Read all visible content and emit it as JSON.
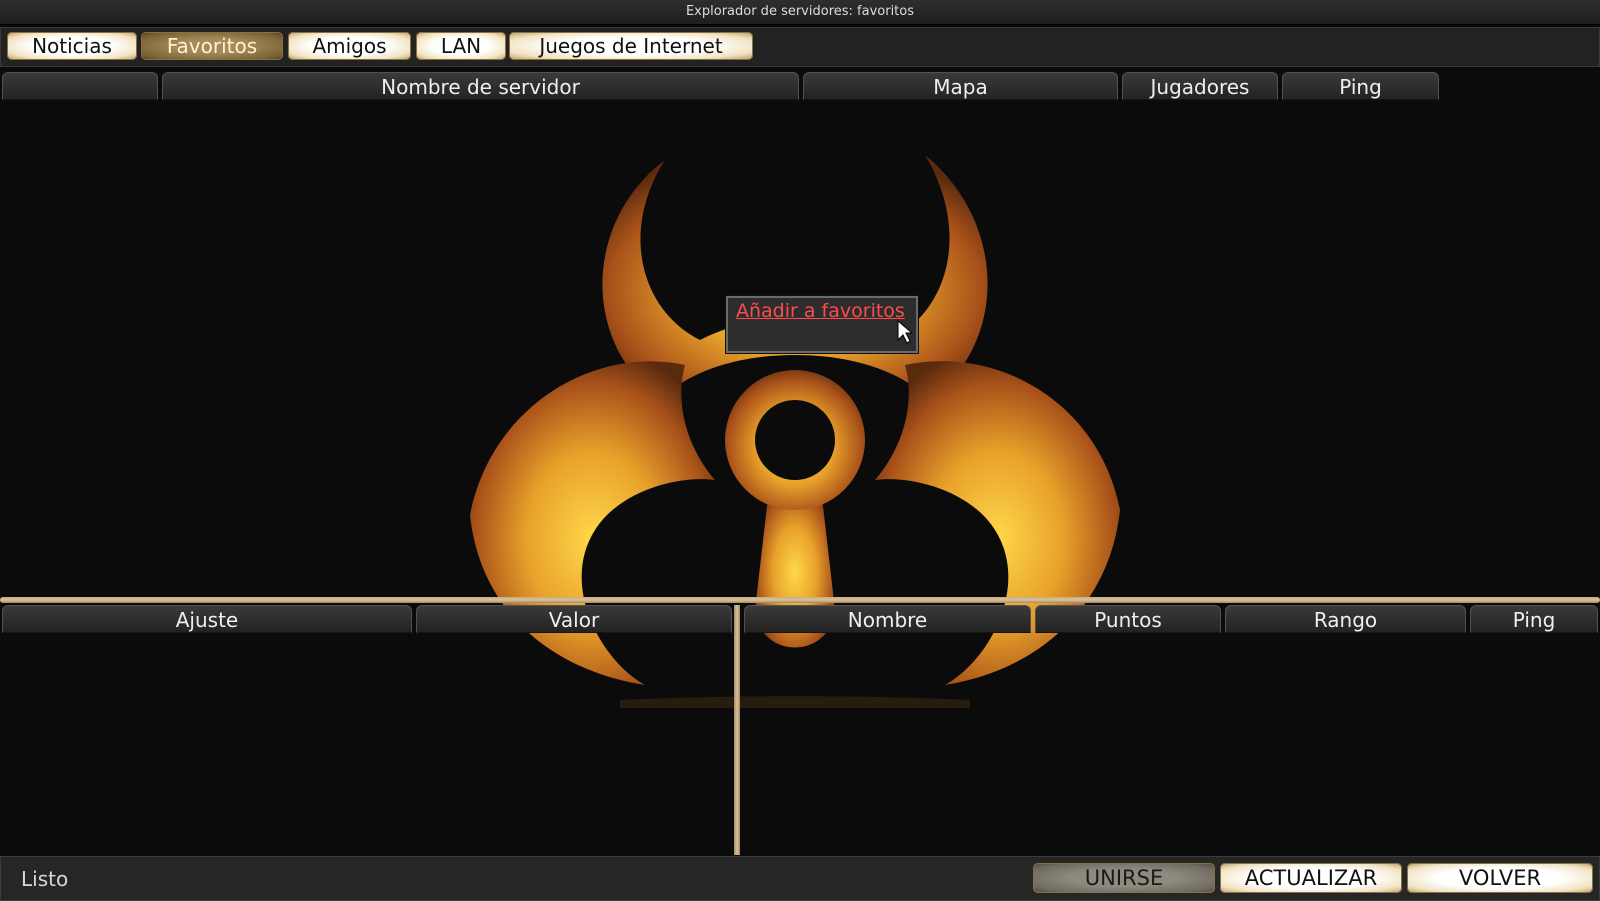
{
  "window": {
    "title": "Explorador de servidores: favoritos"
  },
  "tabs": [
    {
      "label": "Noticias",
      "active": false
    },
    {
      "label": "Favoritos",
      "active": true
    },
    {
      "label": "Amigos",
      "active": false
    },
    {
      "label": "LAN",
      "active": false
    },
    {
      "label": "Juegos de Internet",
      "active": false
    }
  ],
  "server_list": {
    "columns": [
      "",
      "Nombre de servidor",
      "Mapa",
      "Jugadores",
      "Ping"
    ]
  },
  "context_menu": {
    "items": [
      "Añadir a favoritos"
    ]
  },
  "settings_panel": {
    "columns": [
      "Ajuste",
      "Valor"
    ]
  },
  "players_panel": {
    "columns": [
      "Nombre",
      "Puntos",
      "Rango",
      "Ping"
    ]
  },
  "status": {
    "text": "Listo"
  },
  "buttons": {
    "join": {
      "label": "UNIRSE",
      "enabled": false
    },
    "refresh": {
      "label": "ACTUALIZAR",
      "enabled": true
    },
    "back": {
      "label": "VOLVER",
      "enabled": true
    }
  },
  "colors": {
    "accent_gold": "#c9ad82",
    "context_item_red": "#ff4b4b",
    "background": "#0b0b0b"
  },
  "background_image": {
    "icon": "biohazard-emblem"
  }
}
